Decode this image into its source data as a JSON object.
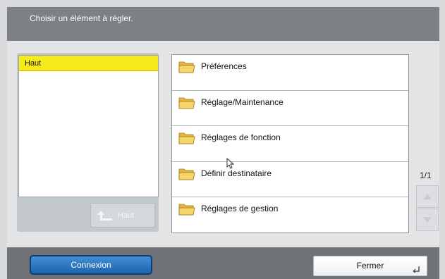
{
  "header": {
    "title": "Choisir un élément à régler."
  },
  "tree": {
    "selected_label": "Haut",
    "up_label": "Haut"
  },
  "menu": {
    "items": [
      {
        "label": "Préférences",
        "icon": "folder-icon"
      },
      {
        "label": "Réglage/Maintenance",
        "icon": "folder-icon"
      },
      {
        "label": "Réglages de fonction",
        "icon": "folder-icon"
      },
      {
        "label": "Définir destinataire",
        "icon": "folder-icon"
      },
      {
        "label": "Réglages de gestion",
        "icon": "folder-icon"
      }
    ]
  },
  "pagination": {
    "text": "1/1"
  },
  "footer": {
    "connexion_label": "Connexion",
    "fermer_label": "Fermer"
  },
  "colors": {
    "selected_highlight": "#f7ea1c",
    "primary_button": "#2a78c4",
    "header_bg": "#7d8186"
  }
}
